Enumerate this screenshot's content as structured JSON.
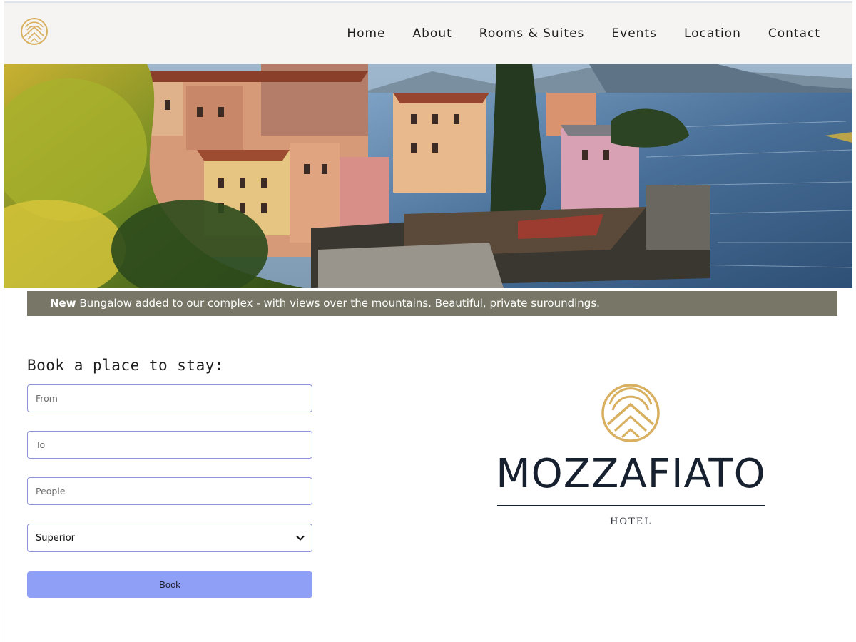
{
  "nav": {
    "items": [
      {
        "label": "Home"
      },
      {
        "label": "About"
      },
      {
        "label": "Rooms & Suites"
      },
      {
        "label": "Events"
      },
      {
        "label": "Location"
      },
      {
        "label": "Contact"
      }
    ]
  },
  "banner": {
    "strong": "New",
    "text": " Bungalow added to our complex - with views over the mountains. Beautiful, private suroundings."
  },
  "booking": {
    "title": "Book a place to stay:",
    "from_placeholder": "From",
    "to_placeholder": "To",
    "people_placeholder": "People",
    "room_selected": "Superior",
    "book_label": "Book"
  },
  "brand": {
    "name": "MOZZAFIATO",
    "subtitle": "HOTEL"
  },
  "colors": {
    "header_bg": "#f6f4f2",
    "banner_bg": "#787767",
    "button_bg": "#8f9ff5",
    "input_border": "#8d93d8",
    "logo_gold": "#d8b05f",
    "brand_navy": "#17202f"
  },
  "icons": {
    "logo": "mountain-sun-logo-icon",
    "select_arrow": "chevron-down-icon"
  }
}
